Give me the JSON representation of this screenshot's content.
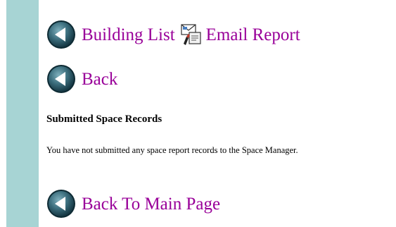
{
  "nav": {
    "building_list_label": "Building List",
    "email_report_label": "Email Report",
    "back_label": "Back",
    "back_to_main_label": "Back To Main Page"
  },
  "section": {
    "title": "Submitted Space Records",
    "message": "You have not submitted any space report records to the Space Manager."
  },
  "colors": {
    "link": "#990099",
    "sidebar": "#a7d4d4",
    "icon_dark": "#1f4a57",
    "icon_light": "#5d8e9c"
  },
  "icons": {
    "back": "back-arrow-circle-icon",
    "email": "email-report-icon"
  }
}
